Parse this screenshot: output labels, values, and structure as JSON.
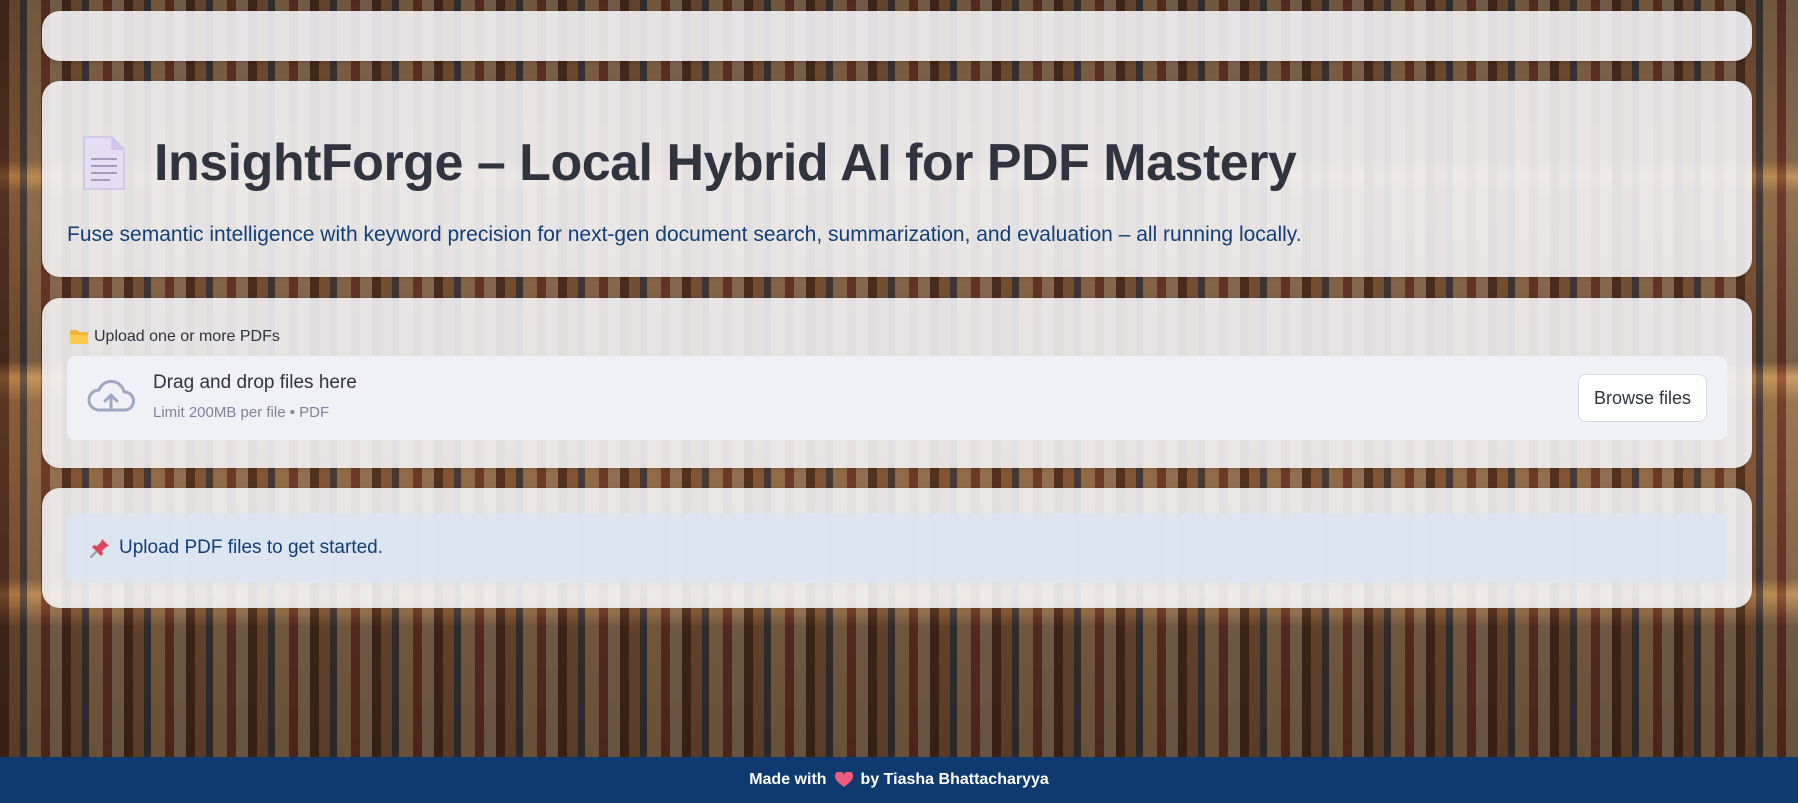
{
  "header": {
    "title": "InsightForge – Local Hybrid AI for PDF Mastery",
    "subtitle": "Fuse semantic intelligence with keyword precision for next-gen document search, summarization, and evaluation – all running locally.",
    "icon": "document-icon"
  },
  "uploader": {
    "label": "Upload one or more PDFs",
    "label_icon": "folder-icon",
    "drop_text": "Drag and drop files here",
    "limit_text": "Limit 200MB per file • PDF",
    "browse_label": "Browse files",
    "icon": "cloud-upload-icon"
  },
  "info": {
    "icon": "pushpin-icon",
    "text": "Upload PDF files to get started."
  },
  "footer": {
    "prefix": "Made with",
    "suffix": "by Tiasha Bhattacharyya",
    "icon": "heart-icon"
  },
  "colors": {
    "title": "#31333f",
    "subtitle": "#123f76",
    "footer_bg": "#0e3a6f",
    "alert_bg": "#dae5f2"
  }
}
